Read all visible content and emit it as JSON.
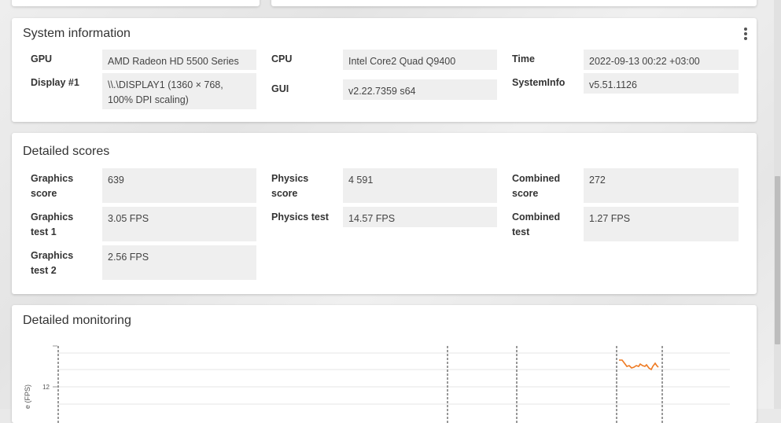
{
  "system_info": {
    "title": "System information",
    "rows": [
      {
        "label": "GPU",
        "value": "AMD Radeon HD 5500 Series"
      },
      {
        "label": "Display #1",
        "value": "\\\\.\\DISPLAY1 (1360 × 768, 100% DPI scaling)"
      },
      {
        "label": "CPU",
        "value": "Intel Core2 Quad Q9400"
      },
      {
        "label": "GUI",
        "value": "v2.22.7359 s64"
      },
      {
        "label": "Time",
        "value": "2022-09-13 00:22 +03:00"
      },
      {
        "label": "SystemInfo",
        "value": "v5.51.1126"
      }
    ]
  },
  "detailed_scores": {
    "title": "Detailed scores",
    "rows": [
      {
        "label": "Graphics score",
        "value": "639"
      },
      {
        "label": "Graphics test 1",
        "value": "3.05 FPS"
      },
      {
        "label": "Graphics test 2",
        "value": "2.56 FPS"
      },
      {
        "label": "Physics score",
        "value": "4 591"
      },
      {
        "label": "Physics test",
        "value": "14.57 FPS"
      },
      {
        "label": "Combined score",
        "value": "272"
      },
      {
        "label": "Combined test",
        "value": "1.27 FPS"
      }
    ]
  },
  "monitoring": {
    "title": "Detailed monitoring",
    "y_tick": "12",
    "y_axis_label": "e (FPS)",
    "line_color": "#ee7a22"
  }
}
